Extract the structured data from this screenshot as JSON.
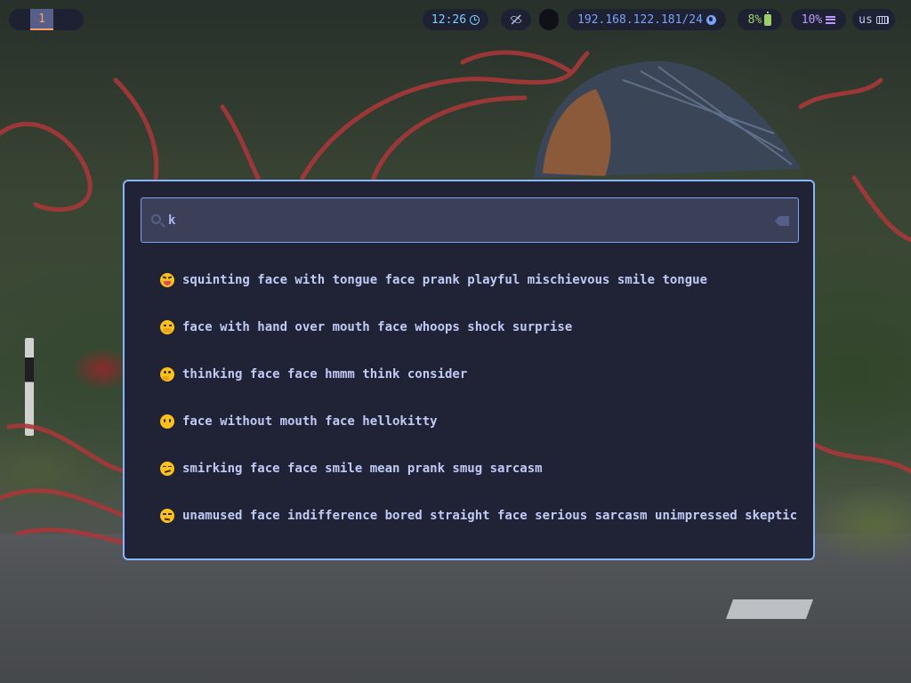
{
  "topbar": {
    "workspaces": [
      {
        "label": "1",
        "active": true
      }
    ],
    "clock": {
      "time": "12:26",
      "icon": "clock-icon"
    },
    "privacy": {
      "icon": "eye-off-icon"
    },
    "network": {
      "ip": "192.168.122.181/24",
      "icon": "globe-icon"
    },
    "battery": {
      "percent": "8%",
      "icon": "battery-icon"
    },
    "cpu": {
      "percent": "10%",
      "icon": "cpu-icon"
    },
    "keyboard": {
      "layout": "us",
      "icon": "keyboard-icon"
    }
  },
  "launcher": {
    "search": {
      "value": "k",
      "placeholder": "",
      "icon": "search-icon",
      "clear_icon": "backspace-icon"
    },
    "results": [
      {
        "emoji": "😝",
        "label": "squinting face with tongue face prank playful mischievous smile tongue"
      },
      {
        "emoji": "🤭",
        "label": "face with hand over mouth face whoops shock surprise"
      },
      {
        "emoji": "🤔",
        "label": "thinking face face hmmm think consider"
      },
      {
        "emoji": "😶",
        "label": "face without mouth face hellokitty"
      },
      {
        "emoji": "😏",
        "label": "smirking face face smile mean prank smug sarcasm"
      },
      {
        "emoji": "😒",
        "label": "unamused face indifference bored straight face serious sarcasm unimpressed skeptical d"
      }
    ]
  },
  "colors": {
    "launcher_bg": "#1f2335",
    "launcher_border": "#89b4fa",
    "search_bg": "#3b4058",
    "text": "#c0caf5",
    "clock": "#7dcfff",
    "network": "#7aa2f7",
    "battery": "#9ece6a",
    "cpu": "#bb9af7",
    "workspace_active": "#ff9e64"
  }
}
